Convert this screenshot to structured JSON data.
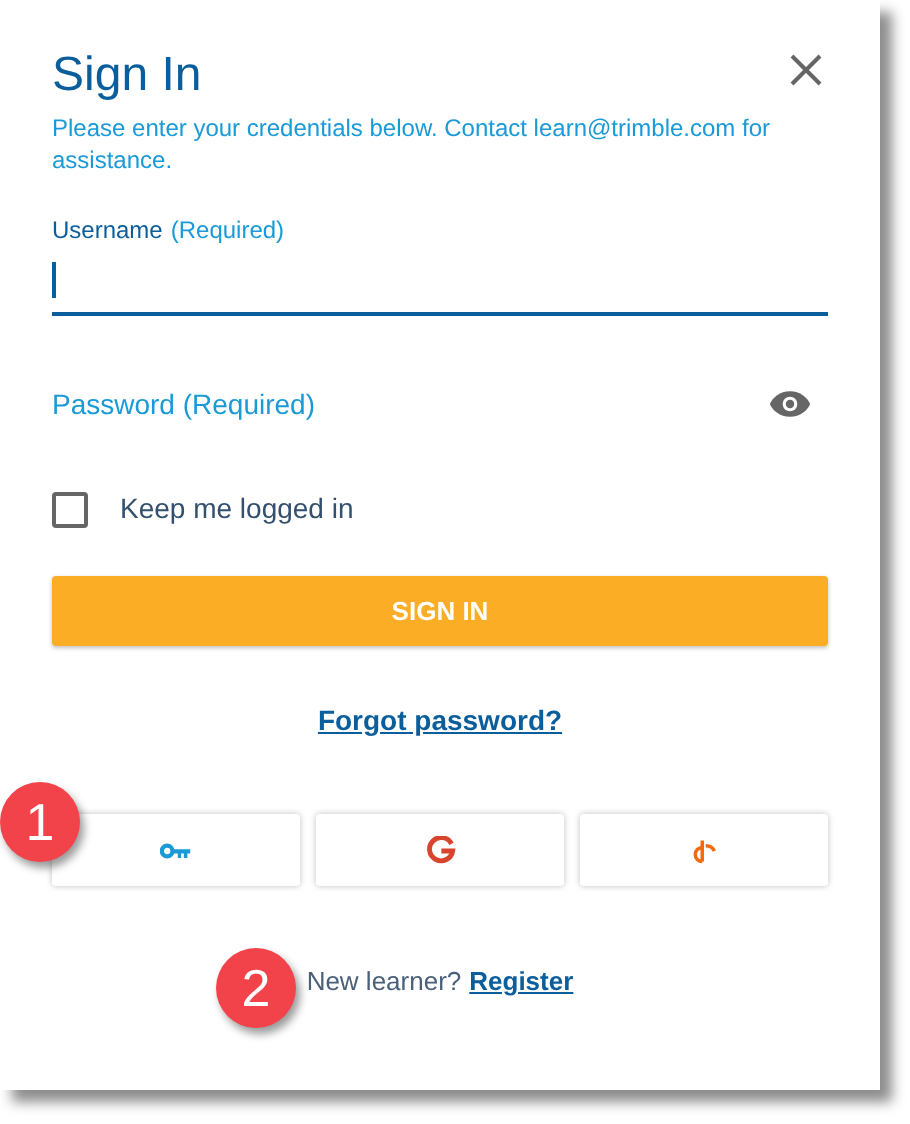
{
  "dialog": {
    "title": "Sign In",
    "description": "Please enter your credentials below. Contact learn@trimble.com for assistance."
  },
  "username": {
    "label": "Username",
    "note": "(Required)",
    "focused": true
  },
  "password": {
    "placeholder": "Password (Required)"
  },
  "remember": {
    "label": "Keep me logged in",
    "checked": false
  },
  "sign_in_button": "SIGN IN",
  "forgot_link": "Forgot password?",
  "sso_buttons": [
    {
      "kind": "key"
    },
    {
      "kind": "google"
    },
    {
      "kind": "openid"
    }
  ],
  "register": {
    "prompt": "New learner?",
    "link": "Register"
  },
  "callouts": [
    "1",
    "2"
  ]
}
